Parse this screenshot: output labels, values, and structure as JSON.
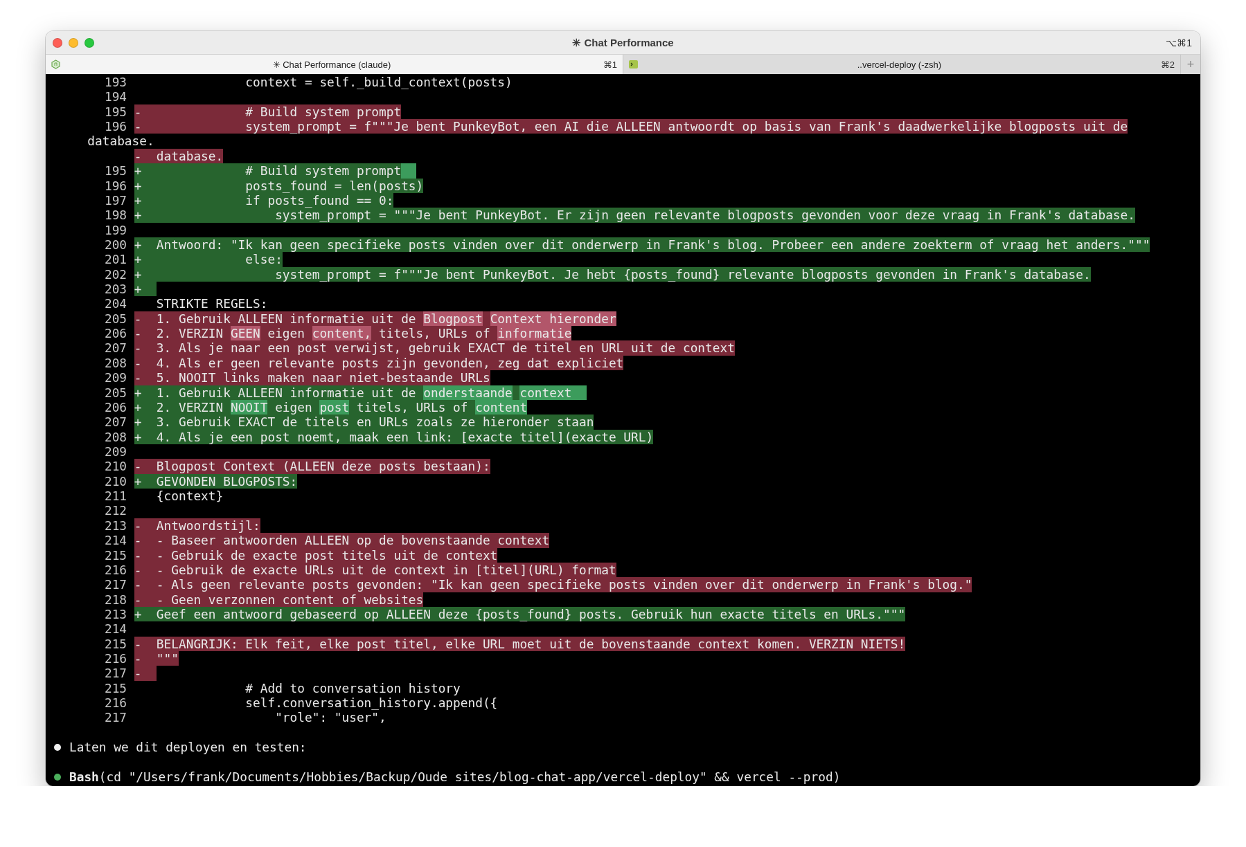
{
  "window": {
    "title": "✳ Chat Performance",
    "shortcut": "⌥⌘1"
  },
  "tabs": [
    {
      "label": "✳ Chat Performance (claude)",
      "shortcut": "⌘1",
      "selected": true
    },
    {
      "label": "..vercel-deploy (-zsh)",
      "shortcut": "⌘2",
      "selected": false
    }
  ],
  "new_tab": "+",
  "diff": [
    {
      "kind": "context",
      "number": "193",
      "text": "            context = self._build_context(posts)"
    },
    {
      "kind": "context",
      "number": "194"
    },
    {
      "kind": "removed",
      "number": "195",
      "sign": "-",
      "text": "            # Build system prompt"
    },
    {
      "kind": "removed",
      "number": "196",
      "sign": "-",
      "text": "            system_prompt = f\"\"\"Je bent PunkeyBot, een AI die ALLEEN antwoordt op basis van Frank's daadwerkelijke blogposts uit de"
    },
    {
      "kind": "wrap",
      "text": "database."
    },
    {
      "kind": "removed",
      "sign": "-",
      "text": "database."
    },
    {
      "kind": "added",
      "number": "195",
      "sign": "+",
      "text": "            # Build system prompt",
      "trailing_marker": true
    },
    {
      "kind": "added",
      "number": "196",
      "sign": "+",
      "text": "            posts_found = len(posts)"
    },
    {
      "kind": "added",
      "number": "197",
      "sign": "+",
      "text": "            if posts_found == 0:"
    },
    {
      "kind": "added",
      "number": "198",
      "sign": "+",
      "text": "                system_prompt = \"\"\"Je bent PunkeyBot. Er zijn geen relevante blogposts gevonden voor deze vraag in Frank's database."
    },
    {
      "kind": "context",
      "number": "199"
    },
    {
      "kind": "added",
      "number": "200",
      "sign": "+",
      "text": "Antwoord: \"Ik kan geen specifieke posts vinden over dit onderwerp in Frank's blog. Probeer een andere zoekterm of vraag het anders.\"\"\""
    },
    {
      "kind": "added",
      "number": "201",
      "sign": "+",
      "text": "            else:"
    },
    {
      "kind": "added",
      "number": "202",
      "sign": "+",
      "text": "                system_prompt = f\"\"\"Je bent PunkeyBot. Je hebt {posts_found} relevante blogposts gevonden in Frank's database."
    },
    {
      "kind": "added",
      "number": "203",
      "sign": "+"
    },
    {
      "kind": "context",
      "number": "204",
      "text": "STRIKTE REGELS:"
    },
    {
      "kind": "removed",
      "number": "205",
      "sign": "-",
      "segments": [
        {
          "text": "1. Gebruik ALLEEN informatie uit de ",
          "emph": false
        },
        {
          "text": "Blogpost",
          "emph": true
        },
        {
          "text": "Context hieronder",
          "emph": true
        }
      ]
    },
    {
      "kind": "removed",
      "number": "206",
      "sign": "-",
      "segments": [
        {
          "text": "2. VERZIN ",
          "emph": false
        },
        {
          "text": "GEEN",
          "emph": true
        },
        {
          "text": " eigen ",
          "emph": false
        },
        {
          "text": "content,",
          "emph": true
        },
        {
          "text": " titels, URLs of ",
          "emph": false
        },
        {
          "text": "informatie",
          "emph": true
        }
      ]
    },
    {
      "kind": "removed",
      "number": "207",
      "sign": "-",
      "text": "3. Als je naar een post verwijst, gebruik EXACT de titel en URL uit de context"
    },
    {
      "kind": "removed",
      "number": "208",
      "sign": "-",
      "text": "4. Als er geen relevante posts zijn gevonden, zeg dat expliciet"
    },
    {
      "kind": "removed",
      "number": "209",
      "sign": "-",
      "text": "5. NOOIT links maken naar niet-bestaande URLs"
    },
    {
      "kind": "added",
      "number": "205",
      "sign": "+",
      "segments": [
        {
          "text": "1. Gebruik ALLEEN informatie uit de ",
          "emph": false
        },
        {
          "text": "onderstaande",
          "emph": true
        },
        {
          "text": "context",
          "emph": true
        }
      ],
      "trailing_marker": true
    },
    {
      "kind": "added",
      "number": "206",
      "sign": "+",
      "segments": [
        {
          "text": "2. VERZIN ",
          "emph": false
        },
        {
          "text": "NOOIT",
          "emph": true
        },
        {
          "text": " eigen ",
          "emph": false
        },
        {
          "text": "post",
          "emph": true
        },
        {
          "text": " titels, URLs of ",
          "emph": false
        },
        {
          "text": "content",
          "emph": true
        }
      ]
    },
    {
      "kind": "added",
      "number": "207",
      "sign": "+",
      "text": "3. Gebruik EXACT de titels en URLs zoals ze hieronder staan"
    },
    {
      "kind": "added",
      "number": "208",
      "sign": "+",
      "text": "4. Als je een post noemt, maak een link: [exacte titel](exacte URL)"
    },
    {
      "kind": "context",
      "number": "209"
    },
    {
      "kind": "removed",
      "number": "210",
      "sign": "-",
      "text": "Blogpost Context (ALLEEN deze posts bestaan):"
    },
    {
      "kind": "added",
      "number": "210",
      "sign": "+",
      "text": "GEVONDEN BLOGPOSTS:"
    },
    {
      "kind": "context",
      "number": "211",
      "text": "{context}"
    },
    {
      "kind": "context",
      "number": "212"
    },
    {
      "kind": "removed",
      "number": "213",
      "sign": "-",
      "text": "Antwoordstijl:"
    },
    {
      "kind": "removed",
      "number": "214",
      "sign": "-",
      "text": "- Baseer antwoorden ALLEEN op de bovenstaande context"
    },
    {
      "kind": "removed",
      "number": "215",
      "sign": "-",
      "text": "- Gebruik de exacte post titels uit de context"
    },
    {
      "kind": "removed",
      "number": "216",
      "sign": "-",
      "text": "- Gebruik de exacte URLs uit de context in [titel](URL) format"
    },
    {
      "kind": "removed",
      "number": "217",
      "sign": "-",
      "text": "- Als geen relevante posts gevonden: \"Ik kan geen specifieke posts vinden over dit onderwerp in Frank's blog.\""
    },
    {
      "kind": "removed",
      "number": "218",
      "sign": "-",
      "text": "- Geen verzonnen content of websites"
    },
    {
      "kind": "added",
      "number": "213",
      "sign": "+",
      "text": "Geef een antwoord gebaseerd op ALLEEN deze {posts_found} posts. Gebruik hun exacte titels en URLs.\"\"\""
    },
    {
      "kind": "context",
      "number": "214"
    },
    {
      "kind": "removed",
      "number": "215",
      "sign": "-",
      "text": "BELANGRIJK: Elk feit, elke post titel, elke URL moet uit de bovenstaande context komen. VERZIN NIETS!"
    },
    {
      "kind": "removed",
      "number": "216",
      "sign": "-",
      "text": "\"\"\""
    },
    {
      "kind": "removed",
      "number": "217",
      "sign": "-"
    },
    {
      "kind": "context",
      "number": "215",
      "text": "            # Add to conversation history"
    },
    {
      "kind": "context",
      "number": "216",
      "text": "            self.conversation_history.append({"
    },
    {
      "kind": "context",
      "number": "217",
      "text": "                \"role\": \"user\","
    }
  ],
  "messages": [
    {
      "kind": "text",
      "text": "Laten we dit deployen en testen:"
    },
    {
      "kind": "tool",
      "text": "**Bash**(cd \"/Users/frank/Documents/Hobbies/Backup/Oude sites/blog-chat-app/vercel-deploy\" && vercel --prod)"
    }
  ]
}
